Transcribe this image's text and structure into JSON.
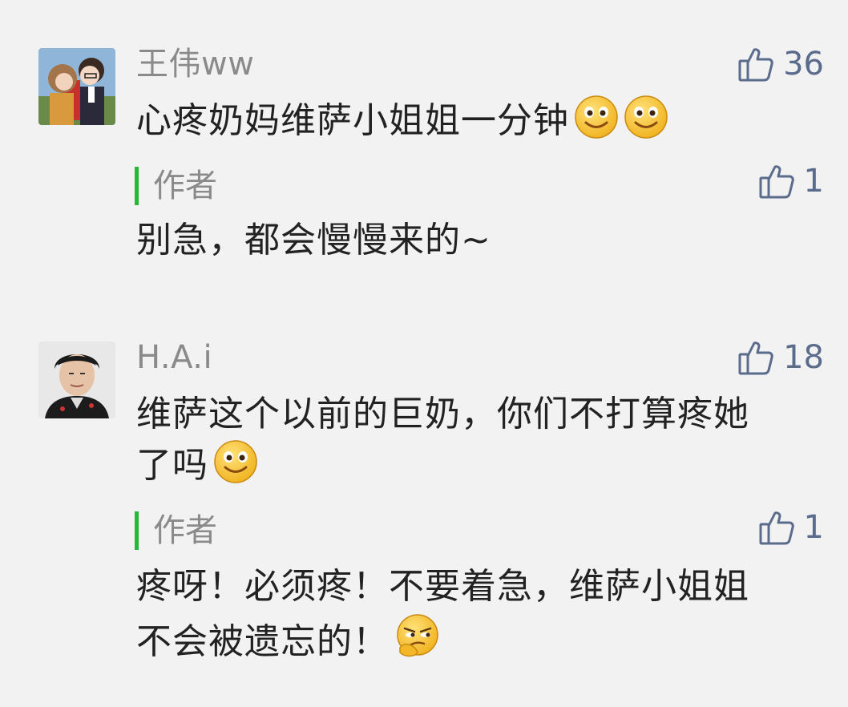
{
  "comments": [
    {
      "user": "王伟ww",
      "likes": "36",
      "text": "心疼奶妈维萨小姐姐一分钟",
      "emojis": [
        "smile-emoji",
        "smile-emoji"
      ],
      "reply": {
        "author_label": "作者",
        "likes": "1",
        "text": "别急，都会慢慢来的~"
      }
    },
    {
      "user": "H.A.i",
      "likes": "18",
      "text_line1": "维萨这个以前的巨奶，你们不打算疼她",
      "text_line2": "了吗",
      "emojis": [
        "smile-emoji"
      ],
      "reply": {
        "author_label": "作者",
        "likes": "1",
        "text_line1": "疼呀！必须疼！不要着急，维萨小姐姐",
        "text_line2": "不会被遗忘的！",
        "emoji": "smirk-emoji"
      }
    }
  ],
  "colors": {
    "background": "#f2f2f2",
    "username": "#8a8a8a",
    "like": "#5a6b8c",
    "author_bar": "#22b83a"
  }
}
